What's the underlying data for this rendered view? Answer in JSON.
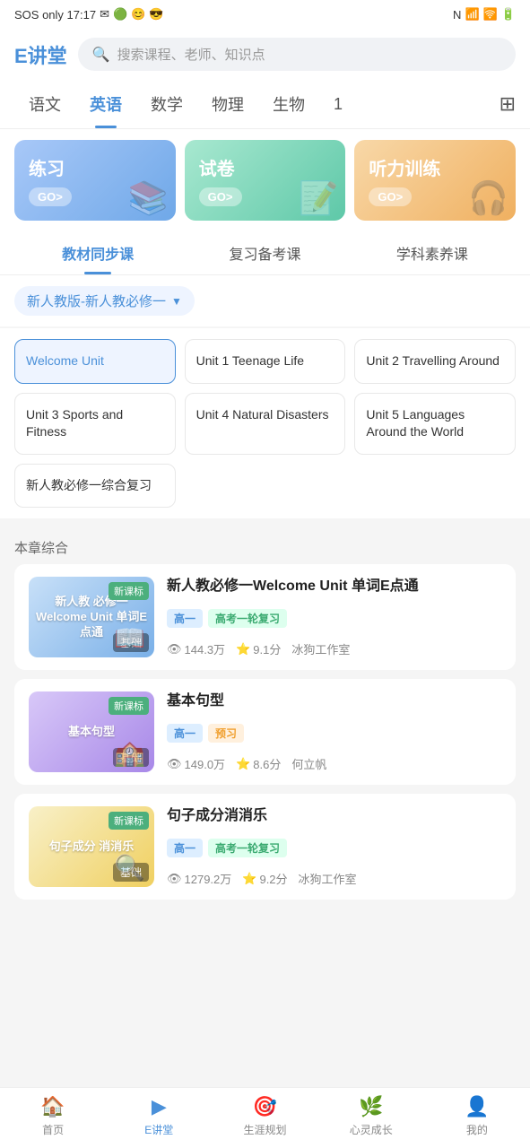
{
  "statusBar": {
    "left": "SOS only  17:17",
    "leftIcons": [
      "✉",
      "🟢",
      "😊",
      "😎"
    ],
    "rightIcons": [
      "N",
      "wifi",
      "battery"
    ]
  },
  "header": {
    "logo": "E讲堂",
    "searchPlaceholder": "搜索课程、老师、知识点"
  },
  "subjectTabs": [
    {
      "label": "语文",
      "active": false
    },
    {
      "label": "英语",
      "active": true
    },
    {
      "label": "数学",
      "active": false
    },
    {
      "label": "物理",
      "active": false
    },
    {
      "label": "生物",
      "active": false
    },
    {
      "label": "1",
      "active": false
    }
  ],
  "banners": [
    {
      "title": "练习",
      "go": "GO>",
      "type": "blue",
      "deco": "📚"
    },
    {
      "title": "试卷",
      "go": "GO>",
      "type": "green",
      "deco": "📝"
    },
    {
      "title": "听力训练",
      "go": "GO>",
      "type": "orange",
      "deco": "🎧"
    }
  ],
  "courseTypeTabs": [
    {
      "label": "教材同步课",
      "active": true
    },
    {
      "label": "复习备考课",
      "active": false
    },
    {
      "label": "学科素养课",
      "active": false
    }
  ],
  "textbookSelector": {
    "label": "新人教版-新人教必修一",
    "arrow": "▼"
  },
  "units": [
    {
      "label": "Welcome Unit",
      "active": true
    },
    {
      "label": "Unit 1 Teenage Life",
      "active": false
    },
    {
      "label": "Unit 2 Travelling Around",
      "active": false
    },
    {
      "label": "Unit 3 Sports and Fitness",
      "active": false
    },
    {
      "label": "Unit 4 Natural Disasters",
      "active": false
    },
    {
      "label": "Unit 5 Languages Around the World",
      "active": false
    },
    {
      "label": "新人教必修一综合复习",
      "active": false
    }
  ],
  "sectionTitle": "本章综合",
  "courses": [
    {
      "id": 1,
      "thumbText": "新人教 必修一\nWelcome Unit\n单词E点通",
      "thumbType": "blue",
      "newBadge": "新课标",
      "levelBadge": "基础",
      "title": "新人教必修一Welcome Unit 单词E点通",
      "tags": [
        {
          "label": "高一",
          "type": "blue"
        },
        {
          "label": "高考一轮复习",
          "type": "green"
        }
      ],
      "views": "144.3万",
      "rating": "9.1分",
      "author": "冰狗工作室"
    },
    {
      "id": 2,
      "thumbText": "基本句型",
      "thumbType": "purple",
      "newBadge": "新课标",
      "levelBadge": "基础",
      "title": "基本句型",
      "tags": [
        {
          "label": "高一",
          "type": "blue"
        },
        {
          "label": "预习",
          "type": "orange"
        }
      ],
      "views": "149.0万",
      "rating": "8.6分",
      "author": "何立帆"
    },
    {
      "id": 3,
      "thumbText": "句子成分\n消消乐",
      "thumbType": "yellow",
      "newBadge": "新课标",
      "levelBadge": "基础",
      "title": "句子成分消消乐",
      "tags": [
        {
          "label": "高一",
          "type": "blue"
        },
        {
          "label": "高考一轮复习",
          "type": "green"
        }
      ],
      "views": "1279.2万",
      "rating": "9.2分",
      "author": "冰狗工作室"
    }
  ],
  "bottomNav": [
    {
      "label": "首页",
      "icon": "🏠",
      "active": false
    },
    {
      "label": "E讲堂",
      "icon": "▶",
      "active": true
    },
    {
      "label": "生涯规划",
      "icon": "🎯",
      "active": false
    },
    {
      "label": "心灵成长",
      "icon": "🌿",
      "active": false
    },
    {
      "label": "我的",
      "icon": "👤",
      "active": false
    }
  ]
}
